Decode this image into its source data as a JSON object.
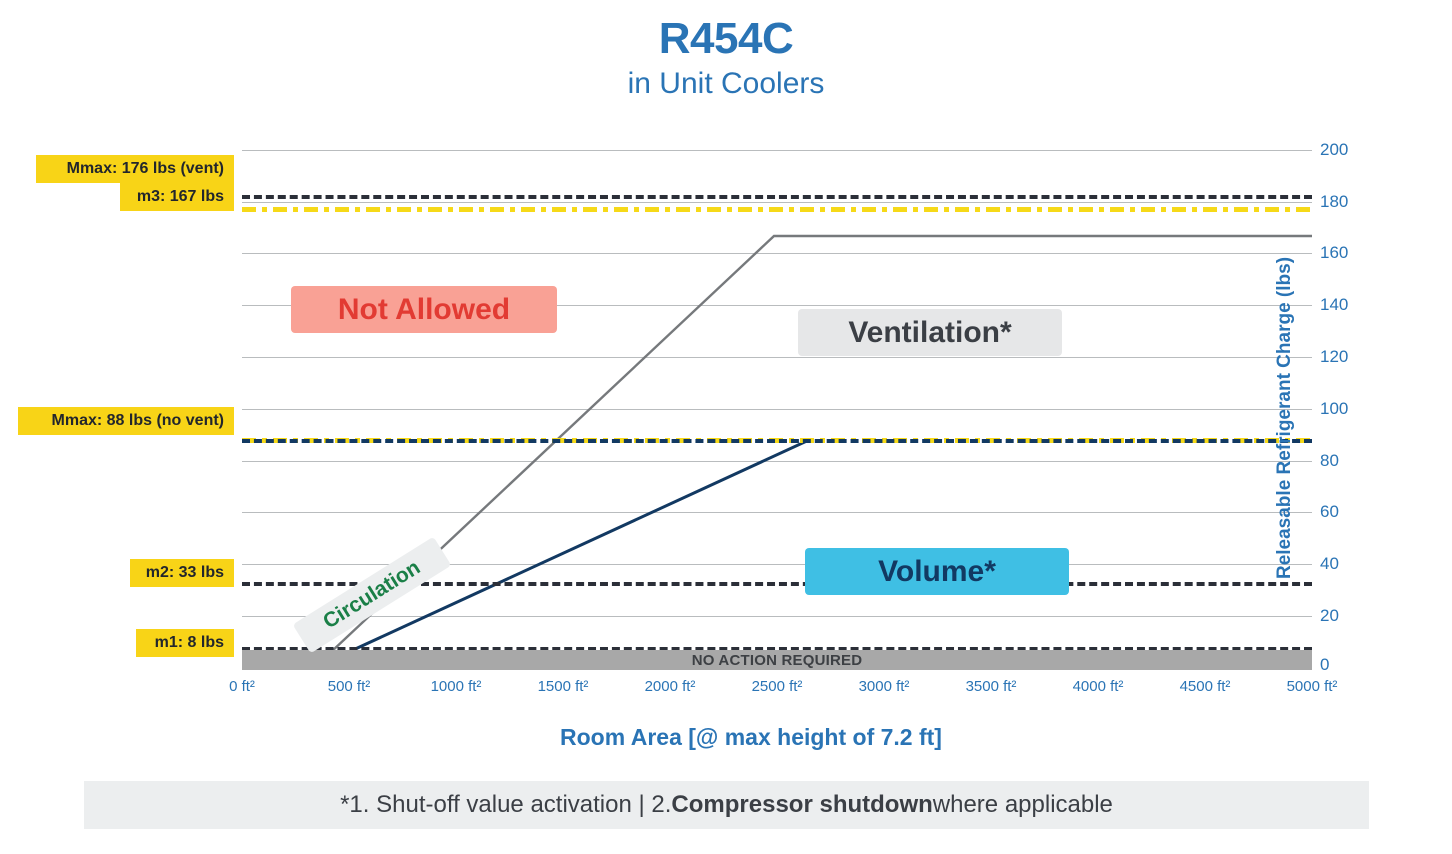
{
  "header": {
    "title": "R454C",
    "subtitle": "in Unit Coolers"
  },
  "axes": {
    "x_title": "Room Area [@ max height of 7.2 ft]",
    "y_title": "Releasable Refrigerant Charge (lbs)"
  },
  "footnote": {
    "prefix": "*1. Shut-off value activation | 2. ",
    "bold": "Compressor shutdown",
    "suffix": " where applicable"
  },
  "zones": {
    "not_allowed": "Not Allowed",
    "ventilation": "Ventilation*",
    "volume": "Volume*",
    "circulation": "Circulation",
    "no_action": "NO ACTION REQUIRED"
  },
  "callouts": [
    {
      "name": "mmax-vent",
      "text": "Mmax: 176 lbs (vent)"
    },
    {
      "name": "m3",
      "text": "m3: 167 lbs"
    },
    {
      "name": "mmax-no-vent",
      "text": "Mmax: 88 lbs (no vent)"
    },
    {
      "name": "m2",
      "text": "m2: 33 lbs"
    },
    {
      "name": "m1",
      "text": "m1: 8 lbs"
    }
  ],
  "colors": {
    "brand_blue": "#2a74b5",
    "yellow": "#f8d417",
    "navy": "#123962",
    "gray_line": "#76797c",
    "red": "#e23b33",
    "cyan": "#3fbfe4",
    "green": "#1a7f47"
  },
  "chart_data": {
    "type": "line",
    "title": "R454C in Unit Coolers",
    "subtitle": "in Unit Coolers",
    "xlabel": "Room Area [@ max height of 7.2 ft]",
    "ylabel": "Releasable Refrigerant Charge (lbs)",
    "xlim": [
      0,
      5000
    ],
    "ylim": [
      0,
      200
    ],
    "grid": true,
    "legend": "none",
    "x_ticks": [
      0,
      500,
      1000,
      1500,
      2000,
      2500,
      3000,
      3500,
      4000,
      4500,
      5000
    ],
    "x_tick_labels": [
      "0 ft²",
      "500 ft²",
      "1000 ft²",
      "1500 ft²",
      "2000 ft²",
      "2500 ft²",
      "3000 ft²",
      "3500 ft²",
      "4000 ft²",
      "4500 ft²",
      "5000 ft²"
    ],
    "y_ticks": [
      0,
      20,
      40,
      60,
      80,
      100,
      120,
      140,
      160,
      180,
      200
    ],
    "y_tick_labels": [
      "0",
      "20",
      "40",
      "60",
      "80",
      "100",
      "120",
      "140",
      "160",
      "180",
      "200"
    ],
    "series": [
      {
        "name": "Ventilation limit (vent)",
        "style": "solid",
        "color": "#76797c",
        "x": [
          340,
          2490,
          5000
        ],
        "y": [
          0,
          167,
          167
        ]
      },
      {
        "name": "Volume limit (no vent)",
        "style": "solid",
        "color": "#123962",
        "x": [
          340,
          2650
        ],
        "y": [
          0,
          88
        ]
      }
    ],
    "threshold_lines": [
      {
        "name": "m3",
        "value": 167,
        "style": "dashed",
        "color": "#2b2f38",
        "label": "m3: 167 lbs"
      },
      {
        "name": "Mmax vent",
        "value": 176,
        "style": "dash-dot",
        "color": "#f6d918",
        "label": "Mmax: 176 lbs (vent)"
      },
      {
        "name": "Mmax no vent",
        "value": 88,
        "style": "dash-dot",
        "color": "#f6d918",
        "label": "Mmax: 88 lbs (no vent)"
      },
      {
        "name": "m2",
        "value": 33,
        "style": "dashed",
        "color": "#2b2f38",
        "label": "m2: 33 lbs"
      },
      {
        "name": "m1",
        "value": 8,
        "style": "dashed",
        "color": "#2b2f38",
        "label": "m1: 8 lbs"
      }
    ],
    "regions": [
      {
        "name": "Not Allowed",
        "color": "#f9a195"
      },
      {
        "name": "Ventilation*",
        "color": "#e6e7e8"
      },
      {
        "name": "Volume*",
        "color": "#3fbfe4"
      },
      {
        "name": "Circulation",
        "color": "#eceeef"
      },
      {
        "name": "NO ACTION REQUIRED",
        "color": "#a8a8a8"
      }
    ]
  }
}
